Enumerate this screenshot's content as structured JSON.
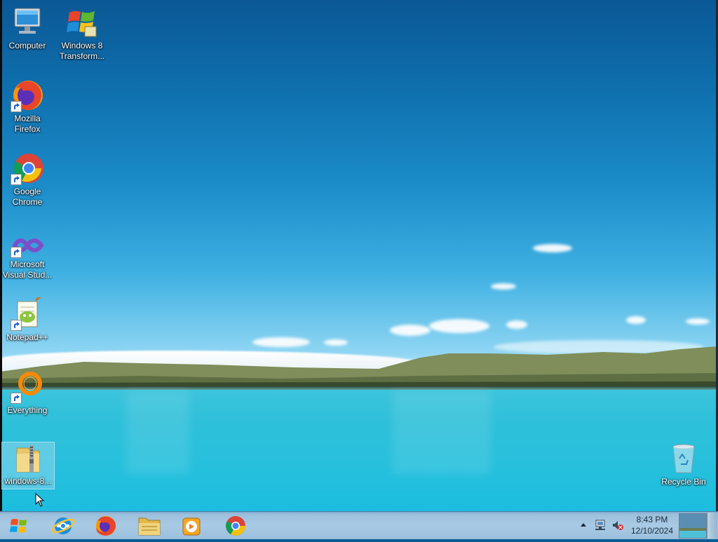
{
  "desktop": {
    "icons": [
      {
        "label": "Computer",
        "icon": "computer-icon"
      },
      {
        "label": "Windows 8\nTransform...",
        "icon": "windows-flag-icon"
      },
      {
        "label": "Mozilla\nFirefox",
        "icon": "firefox-icon"
      },
      {
        "label": "Google\nChrome",
        "icon": "chrome-icon"
      },
      {
        "label": "Microsoft\nVisual Stud...",
        "icon": "visual-studio-icon"
      },
      {
        "label": "Notepad++",
        "icon": "notepad-plus-plus-icon"
      },
      {
        "label": "Everything",
        "icon": "everything-search-icon"
      },
      {
        "label": "windows-8...",
        "icon": "zip-folder-icon",
        "selected": true
      },
      {
        "label": "Recycle Bin",
        "icon": "recycle-bin-icon"
      }
    ]
  },
  "taskbar": {
    "start_icon": "windows-start-orb-icon",
    "pinned": [
      {
        "name": "Internet Explorer",
        "icon": "internet-explorer-icon"
      },
      {
        "name": "Mozilla Firefox",
        "icon": "firefox-icon"
      },
      {
        "name": "Windows Explorer",
        "icon": "file-explorer-icon"
      },
      {
        "name": "Windows Media Player",
        "icon": "media-player-icon"
      },
      {
        "name": "Google Chrome",
        "icon": "chrome-icon"
      }
    ],
    "tray_icons": [
      "show-hidden-icons-arrow-icon",
      "network-icon",
      "volume-muted-icon"
    ],
    "time": "8:43 PM",
    "date": "12/10/2024"
  },
  "colors": {
    "taskbar": "#a9cae4",
    "sky_top": "#0b5896",
    "lake": "#2fc0da"
  }
}
